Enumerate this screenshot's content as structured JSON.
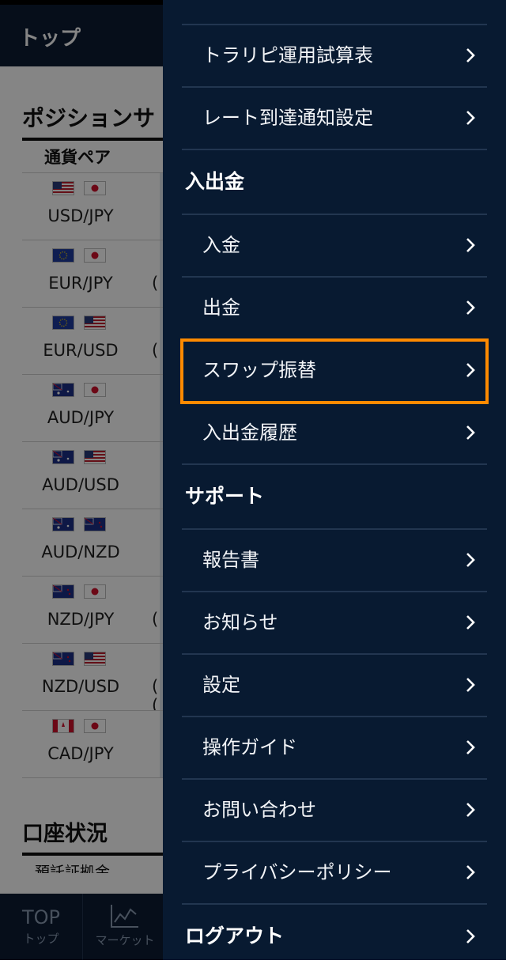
{
  "background": {
    "header_title": "トップ",
    "position_section_title": "ポジションサ",
    "column_header": "通貨ペア",
    "pairs": [
      {
        "name": "USD/JPY",
        "paren": ""
      },
      {
        "name": "EUR/JPY",
        "paren": "("
      },
      {
        "name": "EUR/USD",
        "paren": "("
      },
      {
        "name": "AUD/JPY",
        "paren": ""
      },
      {
        "name": "AUD/USD",
        "paren": ""
      },
      {
        "name": "AUD/NZD",
        "paren": ""
      },
      {
        "name": "NZD/JPY",
        "paren": "("
      },
      {
        "name": "NZD/USD",
        "paren": "( ("
      },
      {
        "name": "CAD/JPY",
        "paren": ""
      }
    ],
    "account_section_title": "口座状況",
    "account_sub": "預託証拠金",
    "footer": {
      "top_big": "TOP",
      "top_small": "トップ",
      "market_small": "マーケット"
    }
  },
  "drawer": {
    "items_top": [
      {
        "label": "トラリピ運用試算表"
      },
      {
        "label": "レート到達通知設定"
      }
    ],
    "section_deposit": "入出金",
    "items_deposit": [
      {
        "label": "入金"
      },
      {
        "label": "出金"
      },
      {
        "label": "スワップ振替",
        "highlighted": true
      },
      {
        "label": "入出金履歴"
      }
    ],
    "section_support": "サポート",
    "items_support": [
      {
        "label": "報告書"
      },
      {
        "label": "お知らせ"
      },
      {
        "label": "設定"
      },
      {
        "label": "操作ガイド"
      },
      {
        "label": "お問い合わせ"
      },
      {
        "label": "プライバシーポリシー"
      }
    ],
    "logout": "ログアウト"
  },
  "colors": {
    "drawer_bg": "#081a31",
    "highlight": "#ff8a00",
    "header_bg": "#0c1c33"
  }
}
